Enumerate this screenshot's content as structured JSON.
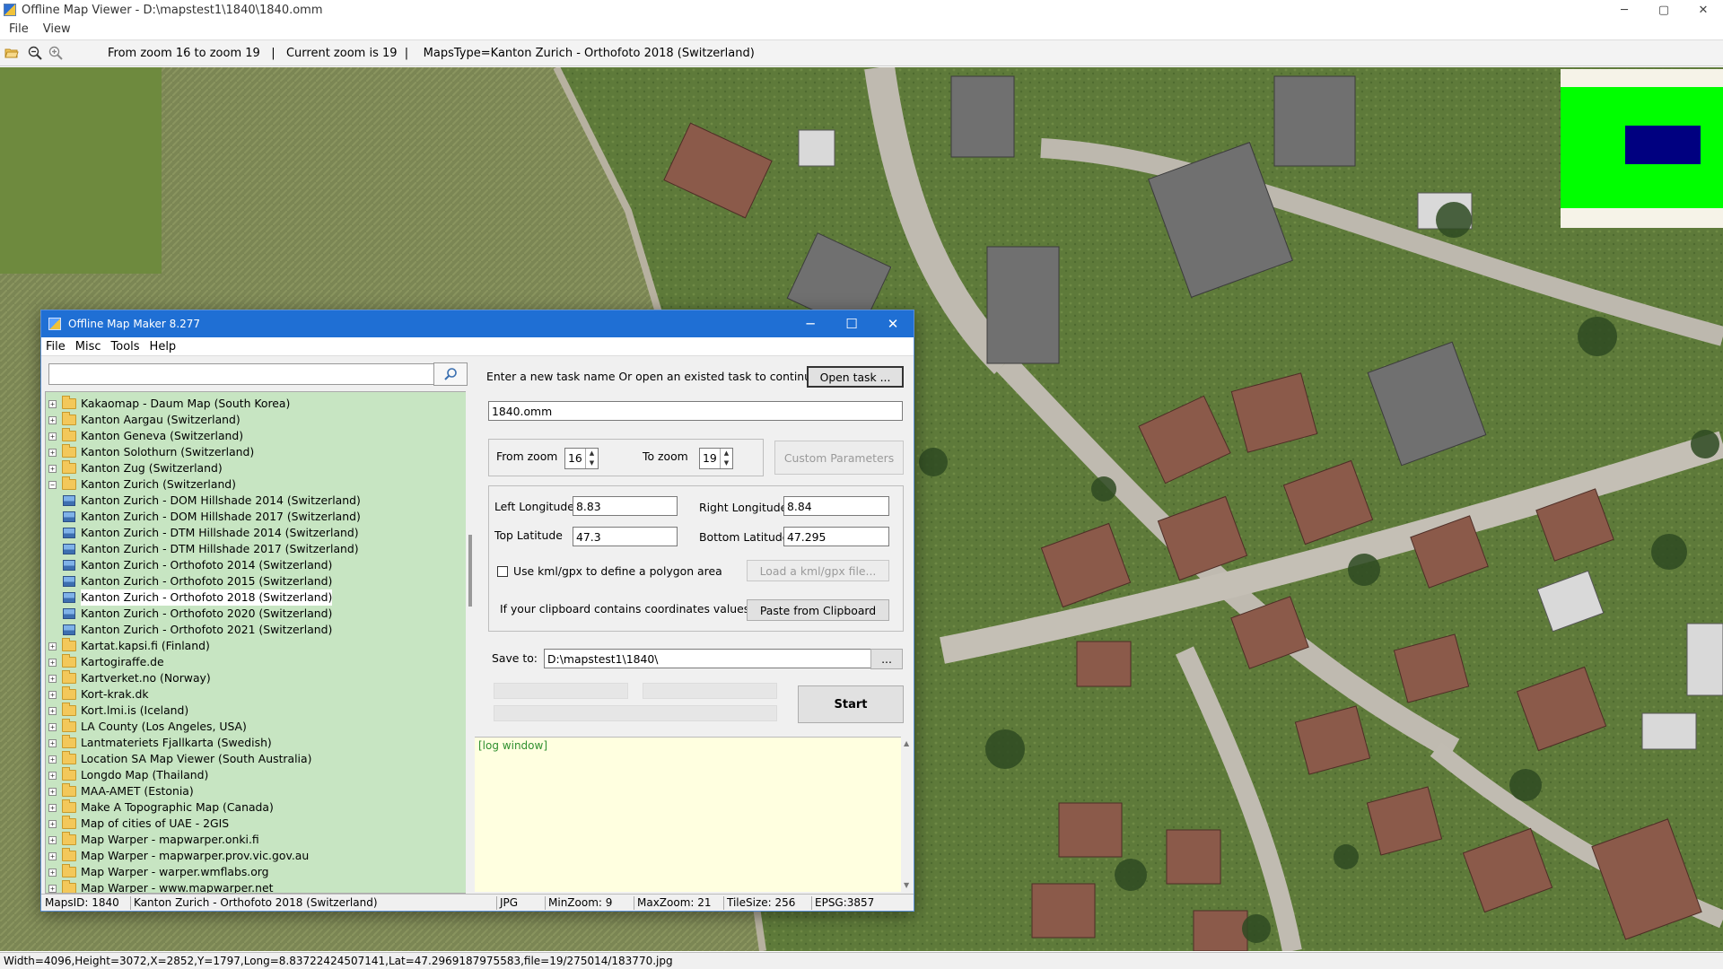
{
  "viewer": {
    "title": "Offline Map Viewer - D:\\mapstest1\\1840\\1840.omm",
    "menu": [
      "File",
      "View"
    ],
    "toolbar_info": "From zoom 16 to zoom 19   |   Current zoom is 19  |    MapsType=Kanton Zurich - Orthofoto 2018 (Switzerland)",
    "status": "Width=4096,Height=3072,X=2852,Y=1797,Long=8.83722424507141,Lat=47.2969187975583,file=19/275014/183770.jpg",
    "window_buttons": {
      "minimize": "─",
      "maximize": "▢",
      "close": "✕"
    }
  },
  "maker": {
    "title": "Offline Map Maker 8.277",
    "menu": [
      "File",
      "Misc",
      "Tools",
      "Help"
    ],
    "window_buttons": {
      "minimize": "─",
      "maximize": "☐",
      "close": "✕"
    },
    "search": {
      "value": "",
      "placeholder": ""
    },
    "tree": [
      {
        "label": "Kakaomap - Daum Map (South Korea)",
        "level": 0,
        "expanded": false
      },
      {
        "label": "Kanton Aargau (Switzerland)",
        "level": 0,
        "expanded": false
      },
      {
        "label": "Kanton Geneva (Switzerland)",
        "level": 0,
        "expanded": false
      },
      {
        "label": "Kanton Solothurn (Switzerland)",
        "level": 0,
        "expanded": false
      },
      {
        "label": "Kanton Zug (Switzerland)",
        "level": 0,
        "expanded": false
      },
      {
        "label": "Kanton Zurich (Switzerland)",
        "level": 0,
        "expanded": true
      },
      {
        "label": "Kanton Zurich - DOM Hillshade 2014 (Switzerland)",
        "level": 1
      },
      {
        "label": "Kanton Zurich - DOM Hillshade 2017 (Switzerland)",
        "level": 1
      },
      {
        "label": "Kanton Zurich - DTM Hillshade 2014 (Switzerland)",
        "level": 1
      },
      {
        "label": "Kanton Zurich - DTM Hillshade 2017 (Switzerland)",
        "level": 1
      },
      {
        "label": "Kanton Zurich - Orthofoto 2014 (Switzerland)",
        "level": 1
      },
      {
        "label": "Kanton Zurich - Orthofoto 2015 (Switzerland)",
        "level": 1
      },
      {
        "label": "Kanton Zurich - Orthofoto 2018 (Switzerland)",
        "level": 1,
        "selected": true
      },
      {
        "label": "Kanton Zurich - Orthofoto 2020 (Switzerland)",
        "level": 1
      },
      {
        "label": "Kanton Zurich - Orthofoto 2021 (Switzerland)",
        "level": 1
      },
      {
        "label": "Kartat.kapsi.fi (Finland)",
        "level": 0,
        "expanded": false
      },
      {
        "label": "Kartogiraffe.de",
        "level": 0,
        "expanded": false
      },
      {
        "label": "Kartverket.no (Norway)",
        "level": 0,
        "expanded": false
      },
      {
        "label": "Kort-krak.dk",
        "level": 0,
        "expanded": false
      },
      {
        "label": "Kort.lmi.is (Iceland)",
        "level": 0,
        "expanded": false
      },
      {
        "label": "LA County (Los Angeles, USA)",
        "level": 0,
        "expanded": false
      },
      {
        "label": "Lantmateriets Fjallkarta (Swedish)",
        "level": 0,
        "expanded": false
      },
      {
        "label": "Location SA Map Viewer (South Australia)",
        "level": 0,
        "expanded": false
      },
      {
        "label": "Longdo Map (Thailand)",
        "level": 0,
        "expanded": false
      },
      {
        "label": "MAA-AMET (Estonia)",
        "level": 0,
        "expanded": false
      },
      {
        "label": "Make A Topographic Map (Canada)",
        "level": 0,
        "expanded": false
      },
      {
        "label": "Map of cities of UAE - 2GIS",
        "level": 0,
        "expanded": false
      },
      {
        "label": "Map Warper - mapwarper.onki.fi",
        "level": 0,
        "expanded": false
      },
      {
        "label": "Map Warper - mapwarper.prov.vic.gov.au",
        "level": 0,
        "expanded": false
      },
      {
        "label": "Map Warper - warper.wmflabs.org",
        "level": 0,
        "expanded": false
      },
      {
        "label": "Map Warper - www.mapwarper.net",
        "level": 0,
        "expanded": false
      }
    ],
    "task_prompt": "Enter a new task name Or open an existed task to continue:",
    "open_task_button": "Open task ...",
    "task_name": "1840.omm",
    "from_zoom_label": "From zoom",
    "from_zoom": "16",
    "to_zoom_label": "To zoom",
    "to_zoom": "19",
    "custom_params_button": "Custom Parameters",
    "left_longitude_label": "Left Longitude",
    "left_longitude": "8.83",
    "right_longitude_label": "Right Longitude",
    "right_longitude": "8.84",
    "top_latitude_label": "Top Latitude",
    "top_latitude": "47.3",
    "bottom_latitude_label": "Bottom Latitude",
    "bottom_latitude": "47.295",
    "kml_checkbox_label": "Use kml/gpx to define a polygon area",
    "kml_checked": false,
    "load_kml_button": "Load a kml/gpx file...",
    "clipboard_prompt": "If your clipboard contains coordinates values:",
    "paste_button": "Paste from Clipboard",
    "save_to_label": "Save to:",
    "save_to": "D:\\mapstest1\\1840\\",
    "browse_button": "...",
    "start_button": "Start",
    "log_text": "[log window]",
    "status": {
      "maps_id": "MapsID: 1840",
      "map_name": "Kanton Zurich - Orthofoto 2018 (Switzerland)",
      "format": "JPG",
      "min_zoom": "MinZoom: 9",
      "max_zoom": "MaxZoom: 21",
      "tile_size": "TileSize: 256",
      "epsg": "EPSG:3857"
    }
  },
  "colors": {
    "titlebar_active": "#1f6fd4",
    "tree_background": "#c7e5c2",
    "log_background": "#ffffe0",
    "overview_green": "#00ff00",
    "overview_navy": "#000080"
  },
  "icons": [
    "open-folder-icon",
    "zoom-out-icon",
    "zoom-in-icon",
    "search-icon",
    "folder-icon",
    "map-layer-icon",
    "expand-icon",
    "collapse-icon"
  ]
}
